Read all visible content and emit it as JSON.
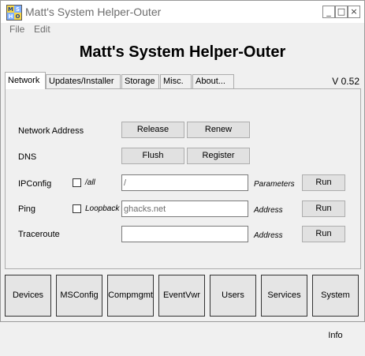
{
  "window": {
    "title": "Matt's System Helper-Outer",
    "icon_letters": [
      "M",
      "S",
      "H",
      "O"
    ],
    "controls": {
      "minimize": "_",
      "maximize": "□",
      "close": "×"
    }
  },
  "menu": [
    "File",
    "Edit"
  ],
  "heading": "Matt's System Helper-Outer",
  "tabs": [
    "Network",
    "Updates/Installer",
    "Storage",
    "Misc.",
    "About..."
  ],
  "active_tab": "Network",
  "version": "V 0.52",
  "network": {
    "network_address": {
      "label": "Network Address",
      "release": "Release",
      "renew": "Renew"
    },
    "dns": {
      "label": "DNS",
      "flush": "Flush",
      "register": "Register"
    },
    "ipconfig": {
      "label": "IPConfig",
      "checkbox_label": "/all",
      "input_value": "/",
      "param_label": "Parameters",
      "run": "Run"
    },
    "ping": {
      "label": "Ping",
      "checkbox_label": "Loopback",
      "input_value": "ghacks.net",
      "param_label": "Address",
      "run": "Run"
    },
    "traceroute": {
      "label": "Traceroute",
      "input_value": "",
      "param_label": "Address",
      "run": "Run"
    }
  },
  "bottom_buttons": [
    "Devices",
    "MSConfig",
    "Compmgmt",
    "EventVwr",
    "Users",
    "Services",
    "System Info"
  ]
}
